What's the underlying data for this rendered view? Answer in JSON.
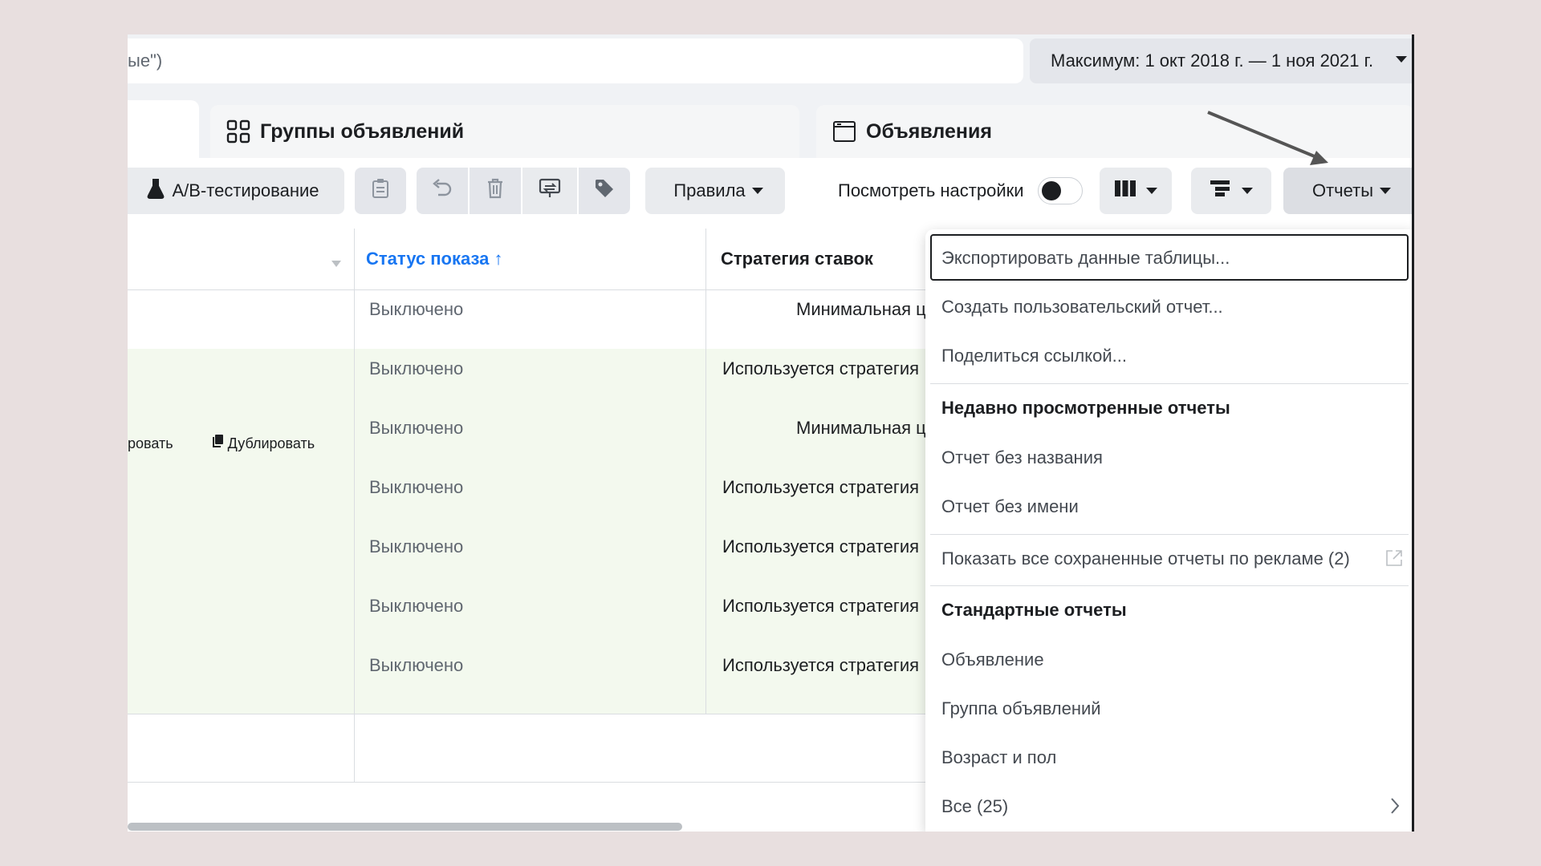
{
  "search": {
    "value": "ые\")"
  },
  "date_range": {
    "label": "Максимум: 1 окт 2018 г. — 1 ноя 2021 г."
  },
  "tabs": [
    {
      "label": "Группы объявлений",
      "icon": "grid-icon"
    },
    {
      "label": "Объявления",
      "icon": "ad-window-icon"
    }
  ],
  "toolbar": {
    "ab_test": "А/В-тестирование",
    "rules": "Правила",
    "view_settings": "Посмотреть настройки",
    "reports": "Отчеты",
    "icons": [
      "clipboard-icon",
      "undo-icon",
      "trash-icon",
      "compare-icon",
      "tag-icon",
      "columns-icon",
      "breakdown-icon"
    ]
  },
  "table": {
    "columns": [
      "Статус показа ↑",
      "Стратегия ставок"
    ],
    "row_actions": {
      "edit": "ровать",
      "duplicate": "Дублировать"
    },
    "rows": [
      {
        "status": "Выключено",
        "strategy": "Минимальная ц"
      },
      {
        "status": "Выключено",
        "strategy": "Используется стратегия"
      },
      {
        "status": "Выключено",
        "strategy": "Минимальная ц"
      },
      {
        "status": "Выключено",
        "strategy": "Используется стратегия"
      },
      {
        "status": "Выключено",
        "strategy": "Используется стратегия"
      },
      {
        "status": "Выключено",
        "strategy": "Используется стратегия"
      },
      {
        "status": "Выключено",
        "strategy": "Используется стратегия"
      }
    ]
  },
  "reports_menu": {
    "export": "Экспортировать данные таблицы...",
    "create_custom": "Создать пользовательский отчет...",
    "share_link": "Поделиться ссылкой...",
    "recent_header": "Недавно просмотренные отчеты",
    "recent": [
      "Отчет без названия",
      "Отчет без имени"
    ],
    "show_all_saved": "Показать все сохраненные отчеты по рекламе (2)",
    "standard_header": "Стандартные отчеты",
    "standard": [
      "Объявление",
      "Группа объявлений",
      "Возраст и пол"
    ],
    "all": "Все (25)"
  },
  "colors": {
    "accent": "#1876f2",
    "row_highlight": "#f3f9ee",
    "button_bg": "#e9ebee"
  }
}
